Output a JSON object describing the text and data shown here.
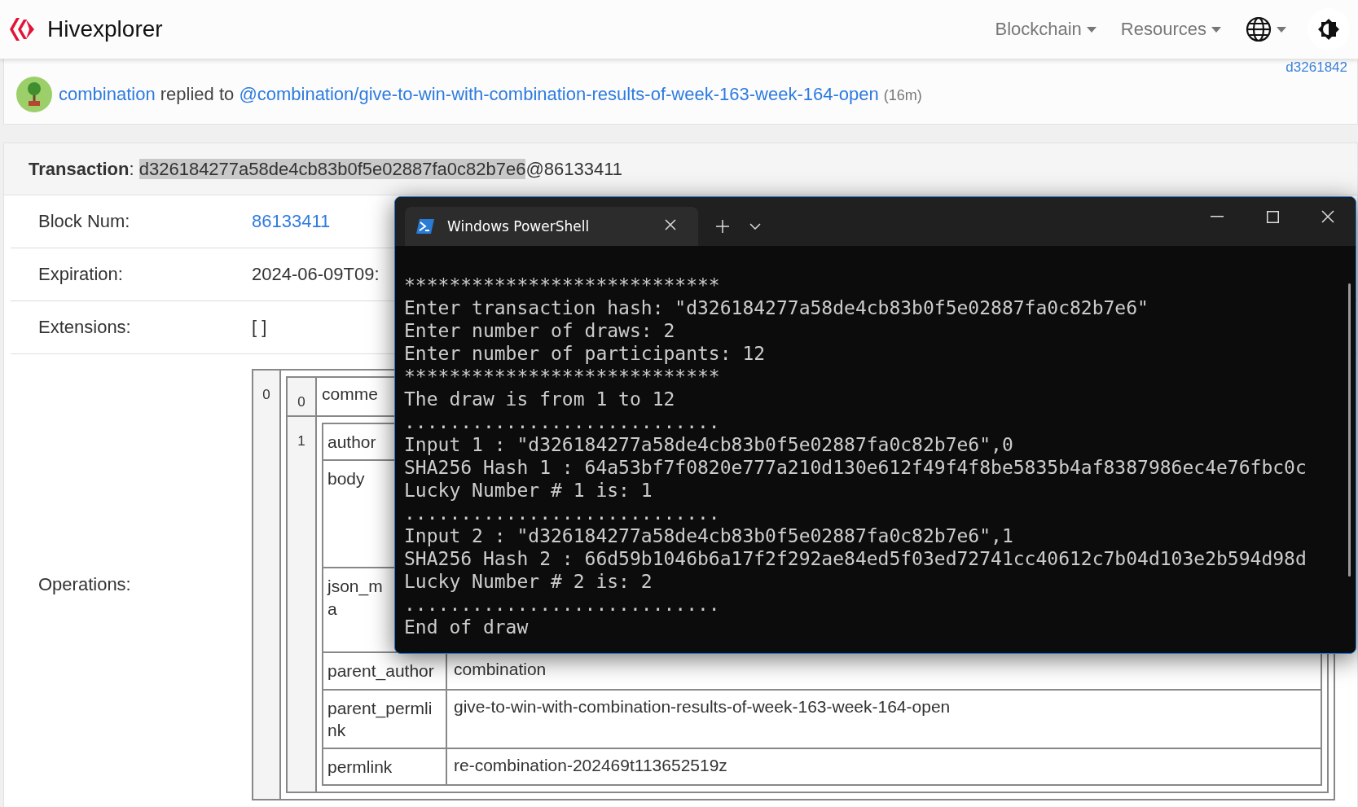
{
  "navbar": {
    "brand": "Hivexplorer",
    "menus": [
      {
        "label": "Blockchain"
      },
      {
        "label": "Resources"
      }
    ]
  },
  "feed": {
    "corner_text": "d3261842",
    "author": "combination",
    "action": "replied to",
    "link": "@combination/give-to-win-with-combination-results-of-week-163-week-164-open",
    "age": "(16m)"
  },
  "transaction": {
    "label": "Transaction",
    "separator": ":",
    "hash": "d326184277a58de4cb83b0f5e02887fa0c82b7e6",
    "suffix": "@86133411",
    "fields": [
      {
        "label": "Block Num:",
        "value": "86133411",
        "link": true
      },
      {
        "label": "Expiration:",
        "value": "2024-06-09T09:",
        "link": false
      },
      {
        "label": "Extensions:",
        "value": "[ ]",
        "link": false
      }
    ],
    "operations": {
      "label": "Operations:",
      "index": "0",
      "op_index": "0",
      "op_type": "comme",
      "body_index": "1",
      "params": [
        {
          "key": "author"
        },
        {
          "key": "body"
        },
        {
          "key": "json_m",
          "key_cont": "a"
        },
        {
          "key": "parent_author",
          "value": "combination"
        },
        {
          "key": "parent_permlink",
          "value": "give-to-win-with-combination-results-of-week-163-week-164-open"
        },
        {
          "key": "permlink",
          "value": "re-combination-202469t113652519z"
        }
      ]
    }
  },
  "terminal": {
    "tab_title": "Windows PowerShell",
    "lines": [
      "****************************",
      "Enter transaction hash: \"d326184277a58de4cb83b0f5e02887fa0c82b7e6\"",
      "Enter number of draws: 2",
      "Enter number of participants: 12",
      "****************************",
      "The draw is from 1 to 12",
      "............................",
      "Input 1 : \"d326184277a58de4cb83b0f5e02887fa0c82b7e6\",0",
      "SHA256 Hash 1 : 64a53bf7f0820e777a210d130e612f49f4f8be5835b4af8387986ec4e76fbc0c",
      "Lucky Number # 1 is: 1",
      "............................",
      "Input 2 : \"d326184277a58de4cb83b0f5e02887fa0c82b7e6\",1",
      "SHA256 Hash 2 : 66d59b1046b6a17f2f292ae84ed5f03ed72741cc40612c7b04d103e2b594d98d",
      "Lucky Number # 2 is: 2",
      "............................",
      "End of draw"
    ]
  }
}
